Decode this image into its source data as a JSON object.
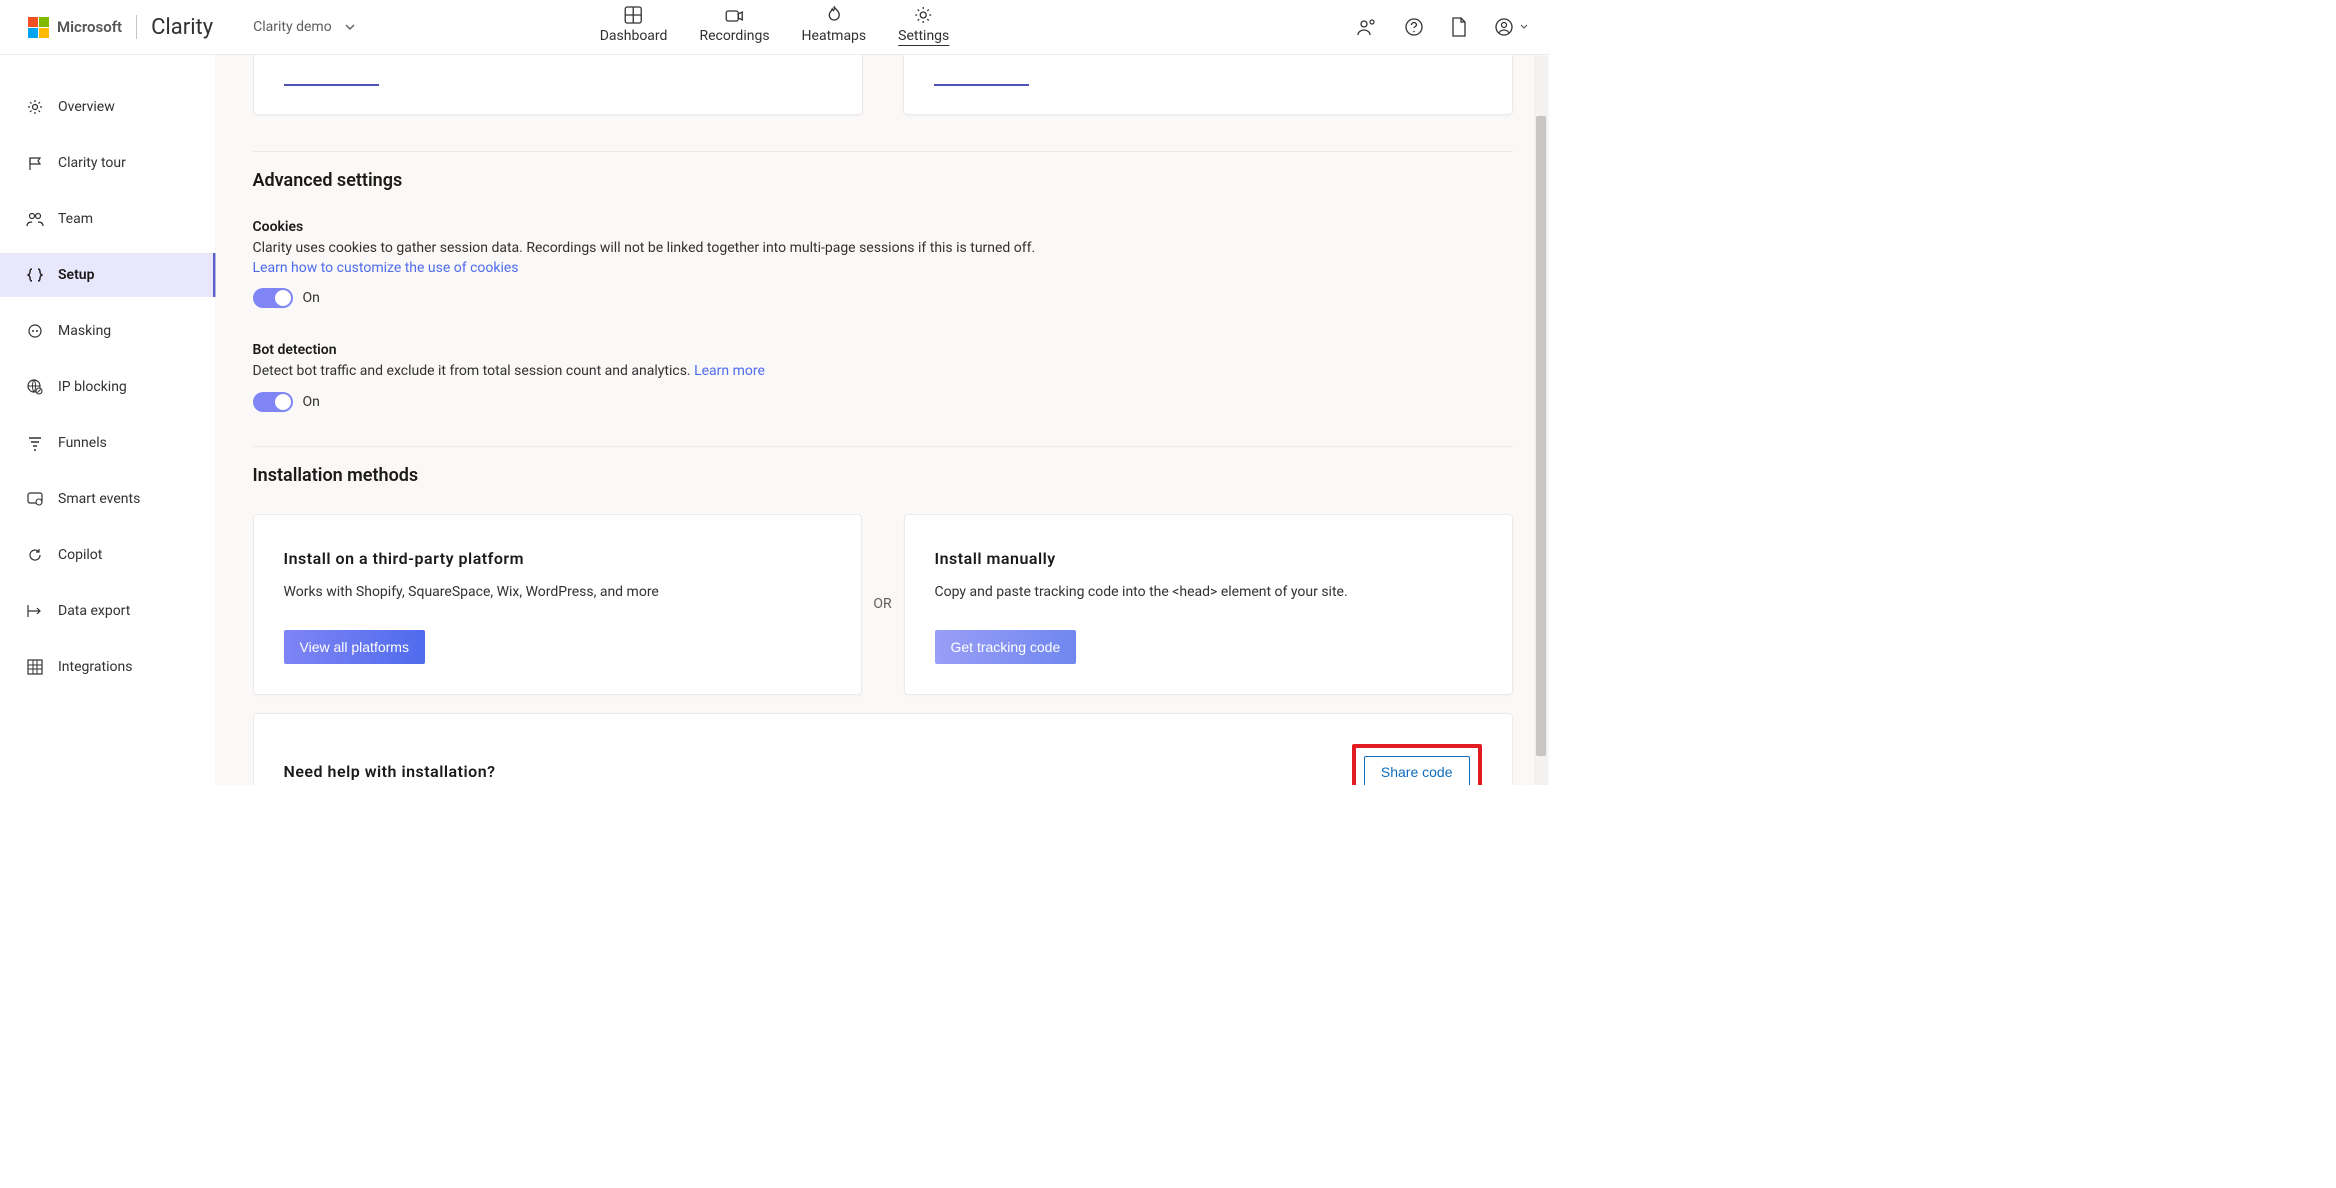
{
  "header": {
    "ms_label": "Microsoft",
    "product": "Clarity",
    "project_name": "Clarity demo"
  },
  "topnav": {
    "dashboard": "Dashboard",
    "recordings": "Recordings",
    "heatmaps": "Heatmaps",
    "settings": "Settings"
  },
  "sidebar": {
    "overview": "Overview",
    "tour": "Clarity tour",
    "team": "Team",
    "setup": "Setup",
    "masking": "Masking",
    "ipblocking": "IP blocking",
    "funnels": "Funnels",
    "smartevents": "Smart events",
    "copilot": "Copilot",
    "dataexport": "Data export",
    "integrations": "Integrations"
  },
  "sections": {
    "advanced_heading": "Advanced settings",
    "cookies": {
      "title": "Cookies",
      "desc": "Clarity uses cookies to gather session data. Recordings will not be linked together into multi-page sessions if this is turned off.",
      "learn_link": "Learn how to customize the use of cookies",
      "state_label": "On"
    },
    "bot": {
      "title": "Bot detection",
      "desc": "Detect bot traffic and exclude it from total session count and analytics. ",
      "learn_link": "Learn more",
      "state_label": "On"
    },
    "install_heading": "Installation methods",
    "install_left": {
      "title": "Install on a third-party platform",
      "desc": "Works with Shopify, SquareSpace, Wix, WordPress, and more",
      "button": "View all platforms"
    },
    "or_label": "OR",
    "install_right": {
      "title": "Install manually",
      "desc": "Copy and paste tracking code into the <head> element of your site.",
      "button": "Get tracking code"
    },
    "help": {
      "title": "Need help with installation?",
      "button": "Share code"
    }
  }
}
